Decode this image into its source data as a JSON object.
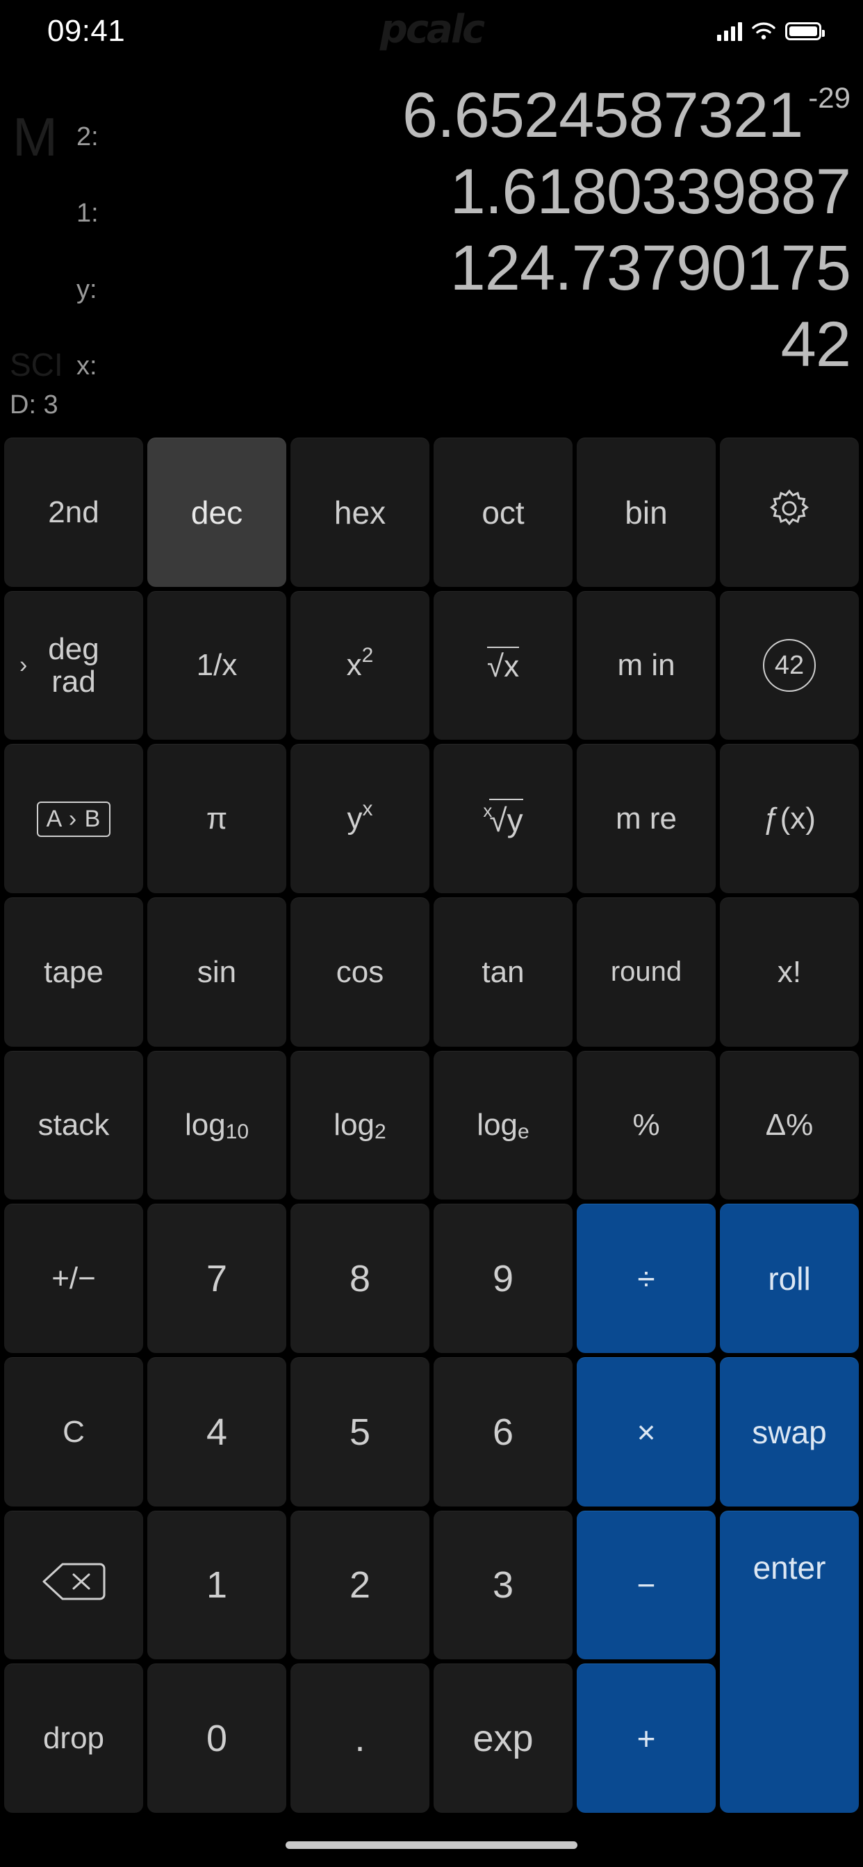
{
  "status_bar": {
    "time": "09:41",
    "watermark": "pcalc",
    "signal_icon": "cellular-signal-icon",
    "wifi_icon": "wifi-icon",
    "battery_icon": "battery-icon"
  },
  "display": {
    "memory_indicator": "M",
    "memory_active": false,
    "sci_indicator": "SCI",
    "sci_active": false,
    "digits_indicator": "D: 3",
    "registers": [
      {
        "label": "2:",
        "value": "6.6524587321",
        "exponent": "-29"
      },
      {
        "label": "1:",
        "value": "1.6180339887",
        "exponent": ""
      },
      {
        "label": "y:",
        "value": "124.73790175",
        "exponent": ""
      },
      {
        "label": "x:",
        "value": "42",
        "exponent": ""
      }
    ]
  },
  "colors": {
    "background": "#000000",
    "key_face": "#1a1a1a",
    "key_active": "#3a3a3a",
    "operator_blue": "#0a4a91",
    "label_gray": "#cfcfcf",
    "display_value": "#bcbcbc"
  },
  "keypad": {
    "row1": [
      {
        "name": "second-function-key",
        "label": "2nd",
        "style": "fn"
      },
      {
        "name": "base-dec-key",
        "label": "dec",
        "style": "active"
      },
      {
        "name": "base-hex-key",
        "label": "hex",
        "style": "merged"
      },
      {
        "name": "base-oct-key",
        "label": "oct",
        "style": "merged"
      },
      {
        "name": "base-bin-key",
        "label": "bin",
        "style": "merged"
      },
      {
        "name": "settings-gear-key",
        "label": "",
        "icon": "gear-icon",
        "style": "fn"
      }
    ],
    "row2": [
      {
        "name": "angle-mode-key",
        "label_top": "deg",
        "label_bottom": "rad",
        "chevron": "›",
        "style": "fn"
      },
      {
        "name": "reciprocal-key",
        "label": "1/x",
        "style": "fn"
      },
      {
        "name": "square-key",
        "label": "x",
        "sup": "2",
        "style": "fn"
      },
      {
        "name": "square-root-key",
        "label": "√x",
        "style": "fn"
      },
      {
        "name": "memory-in-key",
        "label": "m in",
        "style": "fn"
      },
      {
        "name": "constants-key",
        "label": "42",
        "shape": "circled",
        "style": "fn"
      }
    ],
    "row3": [
      {
        "name": "unit-conversion-key",
        "label": "A › B",
        "shape": "boxed",
        "style": "fn"
      },
      {
        "name": "pi-key",
        "label": "π",
        "style": "fn"
      },
      {
        "name": "power-key",
        "label": "y",
        "sup": "x",
        "style": "fn"
      },
      {
        "name": "nth-root-key",
        "label": "√y",
        "idx": "x",
        "style": "fn"
      },
      {
        "name": "memory-recall-key",
        "label": "m re",
        "style": "fn"
      },
      {
        "name": "functions-key",
        "label": "ƒ(x)",
        "style": "fn"
      }
    ],
    "row4": [
      {
        "name": "tape-key",
        "label": "tape",
        "style": "fn"
      },
      {
        "name": "sine-key",
        "label": "sin",
        "style": "fn"
      },
      {
        "name": "cosine-key",
        "label": "cos",
        "style": "fn"
      },
      {
        "name": "tangent-key",
        "label": "tan",
        "style": "fn"
      },
      {
        "name": "round-key",
        "label": "round",
        "style": "fn"
      },
      {
        "name": "factorial-key",
        "label": "x!",
        "style": "fn"
      }
    ],
    "row5": [
      {
        "name": "stack-key",
        "label": "stack",
        "style": "fn"
      },
      {
        "name": "log10-key",
        "label": "log",
        "sub": "10",
        "style": "fn"
      },
      {
        "name": "log2-key",
        "label": "log",
        "sub": "2",
        "style": "fn"
      },
      {
        "name": "ln-key",
        "label": "log",
        "sub": "e",
        "style": "fn"
      },
      {
        "name": "percent-key",
        "label": "%",
        "style": "fn"
      },
      {
        "name": "delta-percent-key",
        "label": "Δ%",
        "style": "fn"
      }
    ],
    "row6": [
      {
        "name": "sign-toggle-key",
        "label": "+/−",
        "style": "fn"
      },
      {
        "name": "digit-7-key",
        "label": "7",
        "style": "num"
      },
      {
        "name": "digit-8-key",
        "label": "8",
        "style": "num"
      },
      {
        "name": "digit-9-key",
        "label": "9",
        "style": "num"
      },
      {
        "name": "divide-key",
        "label": "÷",
        "style": "op"
      },
      {
        "name": "roll-key",
        "label": "roll",
        "style": "op"
      }
    ],
    "row7": [
      {
        "name": "clear-key",
        "label": "C",
        "style": "fn"
      },
      {
        "name": "digit-4-key",
        "label": "4",
        "style": "num"
      },
      {
        "name": "digit-5-key",
        "label": "5",
        "style": "num"
      },
      {
        "name": "digit-6-key",
        "label": "6",
        "style": "num"
      },
      {
        "name": "multiply-key",
        "label": "×",
        "style": "op"
      },
      {
        "name": "swap-key",
        "label": "swap",
        "style": "op"
      }
    ],
    "row8": [
      {
        "name": "backspace-key",
        "label": "",
        "icon": "backspace-icon",
        "style": "fn"
      },
      {
        "name": "digit-1-key",
        "label": "1",
        "style": "num"
      },
      {
        "name": "digit-2-key",
        "label": "2",
        "style": "num"
      },
      {
        "name": "digit-3-key",
        "label": "3",
        "style": "num"
      },
      {
        "name": "subtract-key",
        "label": "−",
        "style": "op"
      },
      {
        "name": "enter-key",
        "label": "enter",
        "style": "op"
      }
    ],
    "row9": [
      {
        "name": "drop-key",
        "label": "drop",
        "style": "fn"
      },
      {
        "name": "digit-0-key",
        "label": "0",
        "style": "num"
      },
      {
        "name": "decimal-point-key",
        "label": ".",
        "style": "num"
      },
      {
        "name": "exponent-key",
        "label": "exp",
        "style": "num"
      },
      {
        "name": "add-key",
        "label": "+",
        "style": "op"
      }
    ]
  },
  "home_indicator": "home-indicator-bar"
}
